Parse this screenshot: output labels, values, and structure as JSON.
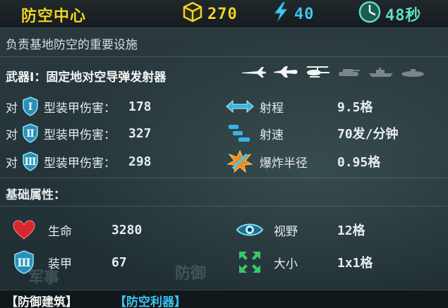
{
  "header": {
    "title": "防空中心",
    "gold": "270",
    "energy": "40",
    "time": "48秒"
  },
  "description": "负责基地防空的重要设施",
  "weapon": {
    "label": "武器Ⅰ：固定地对空导弹发射器",
    "targets": [
      "fighter-jet-icon",
      "bomber-icon",
      "helicopter-icon",
      "tank-icon",
      "warship-icon",
      "submarine-icon"
    ]
  },
  "armor_damage": [
    {
      "prefix": "对",
      "tier": "Ⅰ",
      "label": "型装甲伤害：",
      "value": "178"
    },
    {
      "prefix": "对",
      "tier": "Ⅱ",
      "label": "型装甲伤害：",
      "value": "327"
    },
    {
      "prefix": "对",
      "tier": "Ⅲ",
      "label": "型装甲伤害：",
      "value": "298"
    }
  ],
  "weapon_stats": [
    {
      "icon": "range-arrows-icon",
      "label": "射程",
      "value": "9.5格"
    },
    {
      "icon": "fire-rate-icon",
      "label": "射速",
      "value": "70发/分钟"
    },
    {
      "icon": "explosion-icon",
      "label": "爆炸半径",
      "value": "0.95格"
    }
  ],
  "base_attributes": {
    "title": "基础属性：",
    "hp": {
      "label": "生命",
      "value": "3280"
    },
    "vision": {
      "label": "视野",
      "value": "12格"
    },
    "armor": {
      "tier": "Ⅲ",
      "label": "装甲",
      "value": "67"
    },
    "size": {
      "label": "大小",
      "value": "1x1格"
    }
  },
  "background_text": {
    "left": "军事",
    "right": "防御"
  },
  "tags": [
    "【防御建筑】",
    "【防空利器】"
  ],
  "colors": {
    "gold": "#f4d22b",
    "energy": "#45c7f0",
    "time": "#5fe1c4",
    "tag_blue": "#39c2f0"
  }
}
